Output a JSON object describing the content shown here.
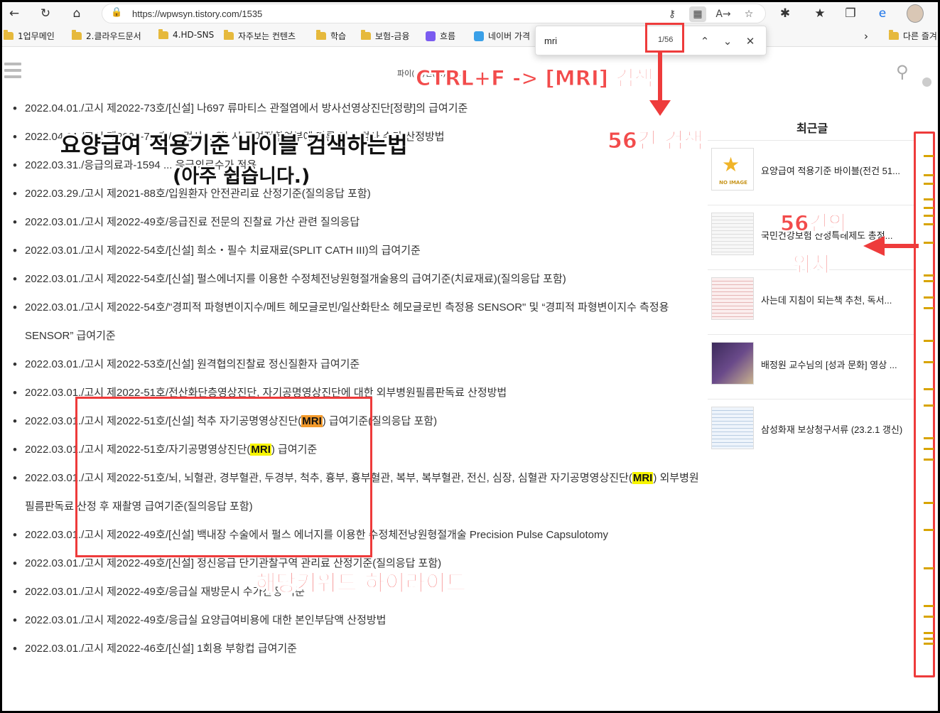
{
  "browser": {
    "url": "https://wpwsyn.tistory.com/1535",
    "bookmarks": [
      {
        "label": "1업무메인",
        "icon": "folder"
      },
      {
        "label": "2.클라우드문서",
        "icon": "folder"
      },
      {
        "label": "4.HD-SNS",
        "icon": "folder"
      },
      {
        "label": "자주보는 컨텐츠",
        "icon": "folder"
      },
      {
        "label": "학습",
        "icon": "folder"
      },
      {
        "label": "보험-금융",
        "icon": "folder"
      },
      {
        "label": "흐름",
        "icon": "app"
      },
      {
        "label": "네이버 가격",
        "icon": "app"
      },
      {
        "label": "다른 즐겨",
        "icon": "folder"
      }
    ]
  },
  "find": {
    "query": "mri",
    "count": "1/56",
    "total_matches": 56
  },
  "page": {
    "blog_title": "파이(...)신(...)북(...)",
    "notices": [
      {
        "parts": [
          {
            "t": "2022.04.01./고시 제2022-73호/[신설] 나697 류마티스 관절염에서 방사선영상진단[정량]의 급여기준"
          }
        ]
      },
      {
        "parts": [
          {
            "t": "2022.04.01./고시 제2022-7...호/... 검사(...외) 시 공여적합여부에 따른 진... 검사 수가 산정방법"
          }
        ]
      },
      {
        "parts": [
          {
            "t": "2022.03.31./응급의료과-1594 ... 응급의료수가 적용"
          }
        ]
      },
      {
        "parts": [
          {
            "t": "2022.03.29./고시 제2021-88호/입원환자 안전관리료 산정기준(질의응답 포함)"
          }
        ]
      },
      {
        "parts": [
          {
            "t": "2022.03.01./고시 제2022-49호/응급진료 전문의 진찰료 가산 관련 질의응답"
          }
        ]
      },
      {
        "parts": [
          {
            "t": "2022.03.01./고시 제2022-54호/[신설] 희소・필수 치료재료(SPLIT CATH III)의 급여기준"
          }
        ]
      },
      {
        "parts": [
          {
            "t": "2022.03.01./고시 제2022-54호/[신설] 펄스에너지를 이용한 수정체전낭원형절개술용의 급여기준(치료재료)(질의응답 포함)"
          }
        ]
      },
      {
        "parts": [
          {
            "t": "2022.03.01./고시 제2022-54호/\"경피적 파형변이지수/메트 헤모글로빈/일산화탄소 헤모글로빈 측정용 SENSOR\" 및 “경피적 파형변이지수 측정용 SENSOR” 급여기준"
          }
        ]
      },
      {
        "parts": [
          {
            "t": "2022.03.01./고시 제2022-53호/[신설] 원격협의진찰료 정신질환자 급여기준"
          }
        ]
      },
      {
        "parts": [
          {
            "t": "2022.03.01./고시 제2022-51호/전산화단층영상진단, 자기공명영상진단에 대한 외부병원필름판독료 산정방법"
          }
        ]
      },
      {
        "parts": [
          {
            "t": "2022.03.01./고시 제2022-51호/[신설] 척추 자기공명영상진단("
          },
          {
            "t": "MRI",
            "hl": "current"
          },
          {
            "t": ") 급여기준(질의응답 포함)"
          }
        ]
      },
      {
        "parts": [
          {
            "t": "2022.03.01./고시 제2022-51호/자기공명영상진단("
          },
          {
            "t": "MRI",
            "hl": "match"
          },
          {
            "t": ") 급여기준"
          }
        ]
      },
      {
        "parts": [
          {
            "t": "2022.03.01./고시 제2022-51호/뇌, 뇌혈관, 경부혈관, 두경부, 척추, 흉부, 흉부혈관, 복부, 복부혈관, 전신, 심장, 심혈관 자기공명영상진단("
          },
          {
            "t": "MRI",
            "hl": "match"
          },
          {
            "t": ") 외부병원필름판독료 산정 후 재촬영 급여기준(질의응답 포함)"
          }
        ]
      },
      {
        "parts": [
          {
            "t": "2022.03.01./고시 제2022-49호/[신설] 백내장 수술에서 펄스 에너지를 이용한 수정체전낭원형절개술 Precision Pulse Capsulotomy"
          }
        ]
      },
      {
        "parts": [
          {
            "t": "2022.03.01./고시 제2022-49호/[신설] 정신응급 단기관찰구역 관리료 산정기준(질의응답 포함)"
          }
        ]
      },
      {
        "parts": [
          {
            "t": "2022.03.01./고시 제2022-49호/응급실 재방문시 수가산정 기준"
          }
        ]
      },
      {
        "parts": [
          {
            "t": "2022.03.01./고시 제2022-49호/응급실 요양급여비용에 대한 본인부담액 산정방법"
          }
        ]
      },
      {
        "parts": [
          {
            "t": "2022.03.01./고시 제2022-46호/[신설] 1회용 부항컵 급여기준"
          }
        ]
      }
    ]
  },
  "sidebar": {
    "title": "최근글",
    "recent": [
      {
        "text": "요양급여 적용기준 바이블(전건 51...",
        "thumb": "no-image"
      },
      {
        "text": "국민건강보험 산정특례제도 총정...",
        "thumb": "document"
      },
      {
        "text": "사는데 지침이 되는책 추천, 독서...",
        "thumb": "document-red"
      },
      {
        "text": "배정원 교수님의 [성과 문화] 영상 ...",
        "thumb": "photo-dark"
      },
      {
        "text": "삼성화재 보상청구서류 (23.2.1 갱신)",
        "thumb": "document-blue"
      }
    ],
    "no_image_label": "NO IMAGE"
  },
  "annotations": {
    "ctrl_f": "CTRL+F -> [MRI] 검색",
    "count_label": "56건 검색",
    "headline_line1": "요양급여 적용기준 바이블 검색하는법",
    "headline_line2": "(아주 쉽습니다.)",
    "positions_line1": "56건의",
    "positions_line2": "위치",
    "highlight_label": "해당키워드 하이라이트"
  },
  "scroll_marker_fractions": [
    0.04,
    0.075,
    0.09,
    0.12,
    0.135,
    0.15,
    0.165,
    0.2,
    0.27,
    0.26,
    0.3,
    0.32,
    0.38,
    0.42,
    0.47,
    0.5,
    0.56,
    0.58,
    0.6,
    0.68,
    0.73,
    0.8,
    0.87,
    0.89,
    0.92,
    0.93,
    0.94
  ]
}
